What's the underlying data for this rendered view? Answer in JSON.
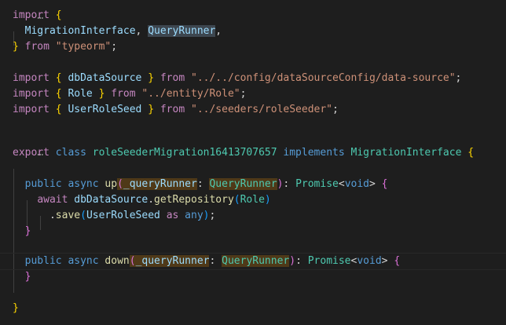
{
  "editor": {
    "fold_top": "…",
    "fold_mid": "…",
    "l_import1_kw": "import",
    "l_import1_brace": "{",
    "l_mig_iface": "MigrationInterface",
    "l_comma": ",",
    "l_qr": "QueryRunner",
    "l_comma2": ",",
    "l_close_brace": "}",
    "l_from1": "from",
    "l_typeorm": "\"typeorm\"",
    "l_semi1": ";",
    "l_import2_kw": "import",
    "l_import2_ob": "{",
    "l_dbds": "dbDataSource",
    "l_import2_cb": "}",
    "l_from2": "from",
    "l_path2": "\"../../config/dataSourceConfig/data-source\"",
    "l_semi2": ";",
    "l_import3_kw": "import",
    "l_import3_ob": "{",
    "l_role": "Role",
    "l_import3_cb": "}",
    "l_from3": "from",
    "l_path3": "\"../entity/Role\"",
    "l_semi3": ";",
    "l_import4_kw": "import",
    "l_import4_ob": "{",
    "l_urs": "UserRoleSeed",
    "l_import4_cb": "}",
    "l_from4": "from",
    "l_path4": "\"../seeders/roleSeeder\"",
    "l_semi4": ";",
    "l_export": "export",
    "l_class": "class",
    "l_classname": "roleSeederMigration16413707657",
    "l_implements": "implements",
    "l_iface2": "MigrationInterface",
    "l_class_ob": "{",
    "l_public1": "public",
    "l_async1": "async",
    "l_up": "up",
    "l_up_op": "(",
    "l_param1": "_queryRunner",
    "l_colon1": ":",
    "l_qrtype1": "QueryRunner",
    "l_up_cp": ")",
    "l_colon1b": ":",
    "l_promise1": "Promise",
    "l_lt1": "<",
    "l_void1": "void",
    "l_gt1": ">",
    "l_up_ob": "{",
    "l_await": "await",
    "l_dbds2": "dbDataSource",
    "l_dot1": ".",
    "l_getrepo": "getRepository",
    "l_gr_op": "(",
    "l_role2": "Role",
    "l_gr_cp": ")",
    "l_dot2": ".",
    "l_save": "save",
    "l_save_op": "(",
    "l_urs2": "UserRoleSeed",
    "l_as": "as",
    "l_any": "any",
    "l_save_cp": ")",
    "l_semi5": ";",
    "l_up_cb": "}",
    "l_public2": "public",
    "l_async2": "async",
    "l_down": "down",
    "l_down_op": "(",
    "l_param2": "_queryRunner",
    "l_colon2": ":",
    "l_qrtype2": "QueryRunner",
    "l_down_cp": ")",
    "l_colon2b": ":",
    "l_promise2": "Promise",
    "l_lt2": "<",
    "l_void2": "void",
    "l_gt2": ">",
    "l_down_ob": "{",
    "l_down_cb": "}",
    "l_class_cb": "}"
  },
  "colors": {
    "background": "#1e1e1e",
    "keyword": "#569cd6",
    "control": "#c586c0",
    "string": "#ce9178",
    "variable": "#9cdcfe",
    "type": "#4ec9b0",
    "function": "#dcdcaa",
    "bracket1": "#ffd700",
    "bracket2": "#da70d6",
    "bracket3": "#179fff"
  }
}
